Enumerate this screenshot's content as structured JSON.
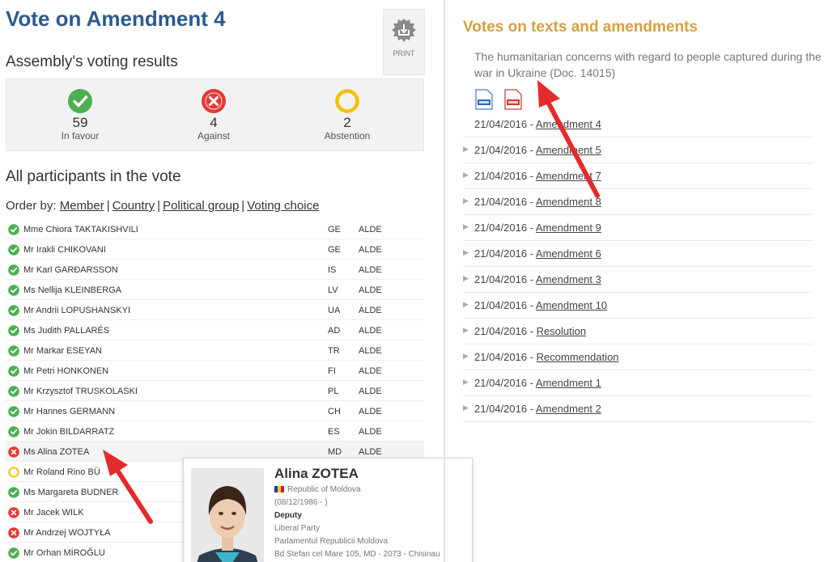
{
  "left": {
    "title": "Vote on Amendment  4",
    "print_label": "PRINT",
    "results_heading": "Assembly's voting results",
    "results": [
      {
        "count": "59",
        "label": "In favour",
        "icon": "check-circle-icon",
        "color": "#4caf50"
      },
      {
        "count": "4",
        "label": "Against",
        "icon": "x-circle-icon",
        "color": "#e53935"
      },
      {
        "count": "2",
        "label": "Abstention",
        "icon": "ring-icon",
        "color": "#f2c200"
      }
    ],
    "participants_heading": "All participants in the vote",
    "order_by": {
      "label": "Order by:",
      "options": [
        "Member",
        "Country",
        "Political group",
        "Voting choice"
      ]
    },
    "participants": [
      {
        "name": "Mme Chiora TAKTAKISHVILI",
        "country": "GE",
        "group": "ALDE",
        "vote": "for"
      },
      {
        "name": "Mr Irakli CHIKOVANI",
        "country": "GE",
        "group": "ALDE",
        "vote": "for"
      },
      {
        "name": "Mr Karl GARÐARSSON",
        "country": "IS",
        "group": "ALDE",
        "vote": "for"
      },
      {
        "name": "Ms Nellija KLEINBERGA",
        "country": "LV",
        "group": "ALDE",
        "vote": "for"
      },
      {
        "name": "Mr Andrii LOPUSHANSKYI",
        "country": "UA",
        "group": "ALDE",
        "vote": "for"
      },
      {
        "name": "Ms Judith PALLARÉS",
        "country": "AD",
        "group": "ALDE",
        "vote": "for"
      },
      {
        "name": "Mr Markar ESEYAN",
        "country": "TR",
        "group": "ALDE",
        "vote": "for"
      },
      {
        "name": "Mr Petri HONKONEN",
        "country": "FI",
        "group": "ALDE",
        "vote": "for"
      },
      {
        "name": "Mr Krzysztof TRUSKOLASKI",
        "country": "PL",
        "group": "ALDE",
        "vote": "for"
      },
      {
        "name": "Mr Hannes GERMANN",
        "country": "CH",
        "group": "ALDE",
        "vote": "for"
      },
      {
        "name": "Mr Jokin BILDARRATZ",
        "country": "ES",
        "group": "ALDE",
        "vote": "for"
      },
      {
        "name": "Ms Alina ZOTEA",
        "country": "MD",
        "group": "ALDE",
        "vote": "against"
      },
      {
        "name": "Mr Roland Rino BÜ",
        "country": "",
        "group": "",
        "vote": "abstain"
      },
      {
        "name": "Ms Margareta BUDNER",
        "country": "",
        "group": "",
        "vote": "for"
      },
      {
        "name": "Mr Jacek WILK",
        "country": "",
        "group": "",
        "vote": "against"
      },
      {
        "name": "Mr Andrzej WOJTYŁA",
        "country": "",
        "group": "",
        "vote": "against"
      },
      {
        "name": "Mr Orhan MİROĞLU",
        "country": "",
        "group": "",
        "vote": "for"
      }
    ],
    "popup": {
      "name": "Alina ZOTEA",
      "country": "Republic of Moldova",
      "dates": "(08/12/1986 - )",
      "role": "Deputy",
      "party": "Liberal Party",
      "parliament": "Parlamentul Republicii Moldova",
      "address": "Bd Stefan cel Mare 105, MD - 2073 - Chisinau"
    }
  },
  "right": {
    "title": "Votes on texts and amendments",
    "description": "The humanitarian concerns with regard to people captured during the war in Ukraine (Doc. 14015)",
    "file_icons": [
      "html-file-icon",
      "pdf-file-icon"
    ],
    "items": [
      {
        "date": "21/04/2016",
        "label": "Amendment 4"
      },
      {
        "date": "21/04/2016",
        "label": "Amendment 5"
      },
      {
        "date": "21/04/2016",
        "label": "Amendment 7"
      },
      {
        "date": "21/04/2016",
        "label": "Amendment 8"
      },
      {
        "date": "21/04/2016",
        "label": "Amendment 9"
      },
      {
        "date": "21/04/2016",
        "label": "Amendment 6"
      },
      {
        "date": "21/04/2016",
        "label": "Amendment 3"
      },
      {
        "date": "21/04/2016",
        "label": "Amendment 10"
      },
      {
        "date": "21/04/2016",
        "label": "Resolution"
      },
      {
        "date": "21/04/2016",
        "label": "Recommendation"
      },
      {
        "date": "21/04/2016",
        "label": "Amendment 1"
      },
      {
        "date": "21/04/2016",
        "label": "Amendment 2"
      }
    ]
  },
  "colors": {
    "title_blue": "#2d5a8e",
    "accent_orange": "#d5a043",
    "arrow_red": "#e32b2b"
  }
}
